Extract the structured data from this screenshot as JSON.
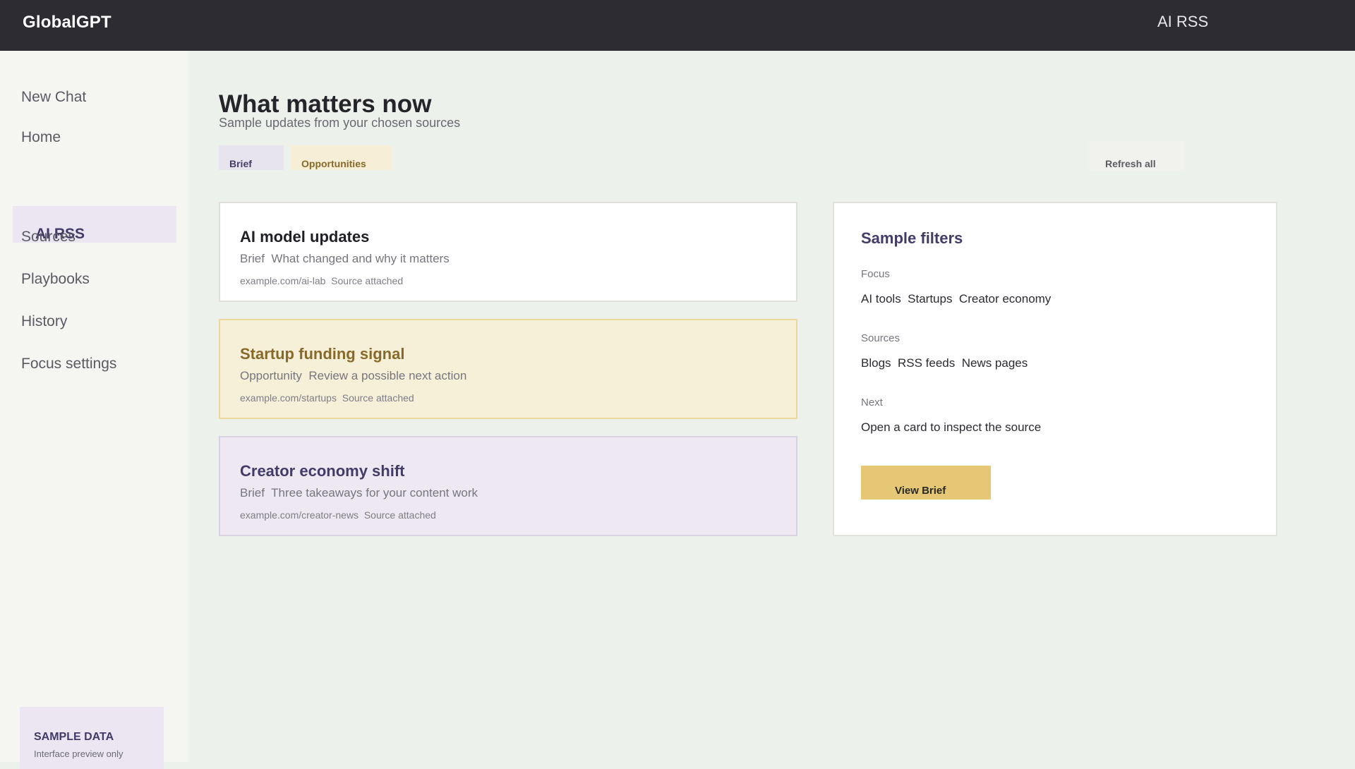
{
  "app": {
    "name": "GlobalGPT",
    "context": "AI RSS"
  },
  "sidebar": {
    "items": [
      {
        "label": "New Chat"
      },
      {
        "label": "Home"
      },
      {
        "label": "AI RSS",
        "active": true
      },
      {
        "label": "Sources"
      },
      {
        "label": "Playbooks"
      },
      {
        "label": "History"
      },
      {
        "label": "Focus settings"
      }
    ],
    "sample_badge": {
      "title": "SAMPLE DATA",
      "subtitle": "Interface preview only"
    }
  },
  "main": {
    "title": "What matters now",
    "subtitle": "Sample updates from your chosen sources",
    "tabs": [
      {
        "label": "Brief"
      },
      {
        "label": "Opportunities"
      }
    ],
    "refresh_label": "Refresh all",
    "cards": [
      {
        "title": "AI model updates",
        "tag": "Brief",
        "summary": "What changed and why it matters",
        "source": "example.com/ai-lab",
        "note": "Source attached"
      },
      {
        "title": "Startup funding signal",
        "tag": "Opportunity",
        "summary": "Review a possible next action",
        "source": "example.com/startups",
        "note": "Source attached"
      },
      {
        "title": "Creator economy shift",
        "tag": "Brief",
        "summary": "Three takeaways for your content work",
        "source": "example.com/creator-news",
        "note": "Source attached"
      }
    ]
  },
  "filters": {
    "title": "Sample filters",
    "groups": [
      {
        "label": "Focus",
        "values": [
          "AI tools",
          "Startups",
          "Creator economy"
        ]
      },
      {
        "label": "Sources",
        "values": [
          "Blogs",
          "RSS feeds",
          "News pages"
        ]
      },
      {
        "label": "Next",
        "values": [
          "Open a card to inspect the source"
        ]
      }
    ],
    "button_label": "View Brief"
  },
  "colors": {
    "topbar": "#2e2c33",
    "sidebar": "#f5f6f2",
    "content_bg": "#edf1eb",
    "accent_purple": "#433b68",
    "accent_gold": "#89692a",
    "button_gold": "#e5c775"
  }
}
